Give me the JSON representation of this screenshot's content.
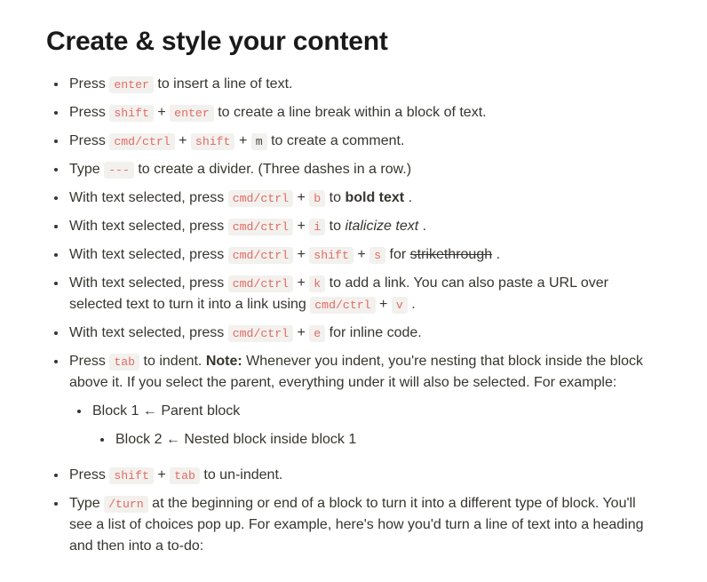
{
  "title": "Create & style your content",
  "txt": {
    "press": "Press ",
    "type": "Type ",
    "withsel": "With text selected, press ",
    "plus": " + ",
    "to_insert_line": " to insert a line of text.",
    "to_linebreak": " to create a line break within a block of text.",
    "to_comment": " to create a comment.",
    "to_divider": " to create a divider. (Three dashes in a row.)",
    "to_": " to ",
    "bold_text": "bold text",
    "period": ".",
    "italicize_text": "italicize text",
    "for_": " for ",
    "strikethrough": "strikethrough",
    "to_add_link": " to add a link. You can also paste a URL over selected text to turn it into a link using ",
    "period_space": " .",
    "for_inline_code": " for inline code.",
    "to_indent": " to indent. ",
    "note_label": "Note:",
    "note_body": " Whenever you indent, you're nesting that block inside the block above it. If you select the parent, everything under it will also be selected. For example:",
    "block1": "Block 1 ← Parent block",
    "block2": "Block 2 ← Nested block inside block 1",
    "to_unindent": " to un-indent.",
    "turn_body": " at the beginning or end of a block to turn it into a different type of block. You'll see a list of choices pop up. For example, here's how you'd turn a line of text into a heading and then into a to-do:"
  },
  "keys": {
    "enter": "enter",
    "shift": "shift",
    "cmdctrl": "cmd/ctrl",
    "m": "m",
    "dashes": "---",
    "b": "b",
    "i": "i",
    "s": "s",
    "k": "k",
    "v": "v",
    "e": "e",
    "tab": "tab",
    "turn": "/turn"
  }
}
